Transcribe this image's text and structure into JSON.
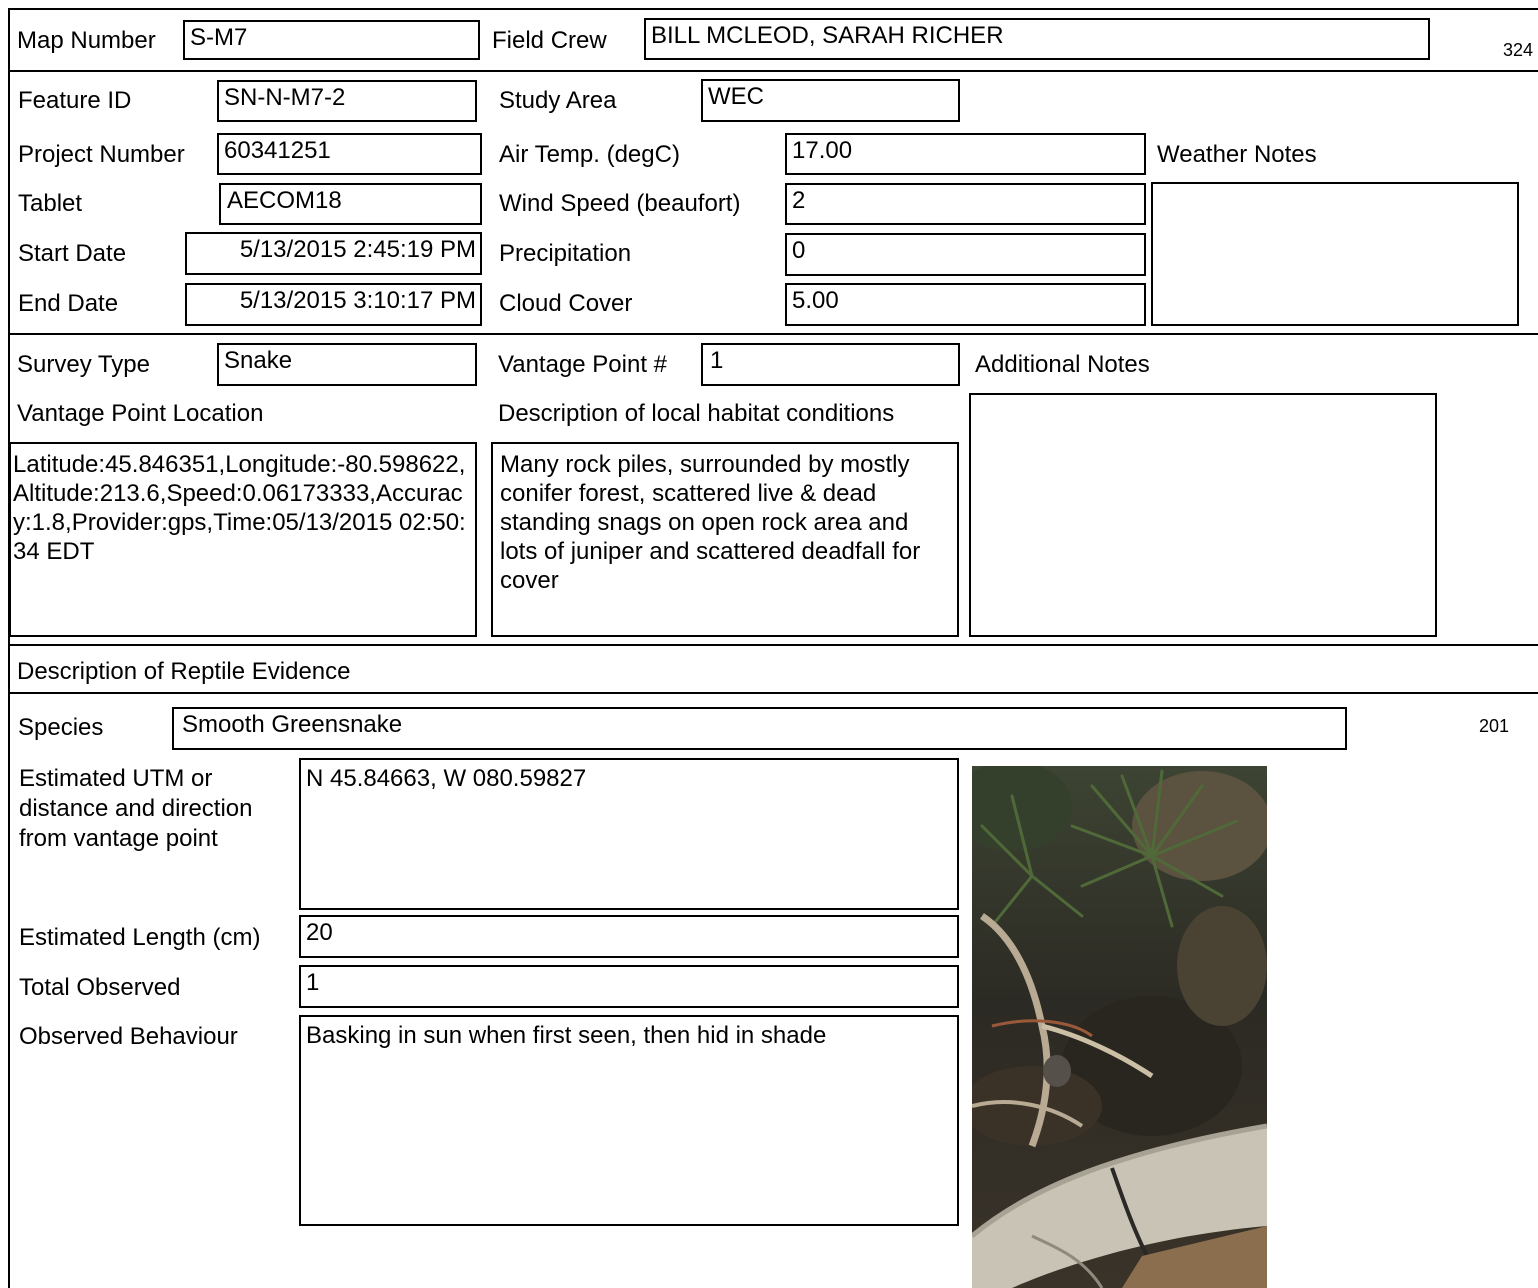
{
  "header": {
    "map_number_label": "Map Number",
    "map_number": "S-M7",
    "field_crew_label": "Field Crew",
    "field_crew": "BILL MCLEOD, SARAH RICHER",
    "page_code": "324"
  },
  "site": {
    "feature_id_label": "Feature ID",
    "feature_id": "SN-N-M7-2",
    "study_area_label": "Study Area",
    "study_area": "WEC",
    "project_number_label": "Project Number",
    "project_number": "60341251",
    "air_temp_label": "Air Temp. (degC)",
    "air_temp": "17.00",
    "weather_notes_label": "Weather Notes",
    "weather_notes": "",
    "tablet_label": "Tablet",
    "tablet": "AECOM18",
    "wind_speed_label": "Wind Speed (beaufort)",
    "wind_speed": "2",
    "start_date_label": "Start Date",
    "start_date": "5/13/2015 2:45:19 PM",
    "precipitation_label": "Precipitation",
    "precipitation": "0",
    "end_date_label": "End Date",
    "end_date": "5/13/2015 3:10:17 PM",
    "cloud_cover_label": "Cloud Cover",
    "cloud_cover": "5.00"
  },
  "survey": {
    "survey_type_label": "Survey Type",
    "survey_type": "Snake",
    "vantage_point_label": "Vantage Point #",
    "vantage_point": "1",
    "additional_notes_label": "Additional Notes",
    "additional_notes": "",
    "vp_location_label": "Vantage Point Location",
    "vp_location": "Latitude:45.846351,Longitude:-80.598622,Altitude:213.6,Speed:0.06173333,Accuracy:1.8,Provider:gps,Time:05/13/2015 02:50:34 EDT",
    "habitat_label": "Description of local habitat conditions",
    "habitat": "Many rock piles,  surrounded by mostly conifer forest,  scattered live & dead standing snags on open rock area and lots of juniper and scattered deadfall for cover"
  },
  "evidence": {
    "section_label": "Description of Reptile Evidence",
    "species_label": "Species",
    "species": "Smooth Greensnake",
    "record_code": "201",
    "utm_label": "Estimated UTM or distance and direction from vantage point",
    "utm": "N 45.84663, W 080.59827",
    "length_label": "Estimated Length (cm)",
    "length": "20",
    "total_label": "Total Observed",
    "total": "1",
    "behaviour_label": "Observed Behaviour",
    "behaviour": "Basking in sun when first seen,  then hid in shade"
  }
}
